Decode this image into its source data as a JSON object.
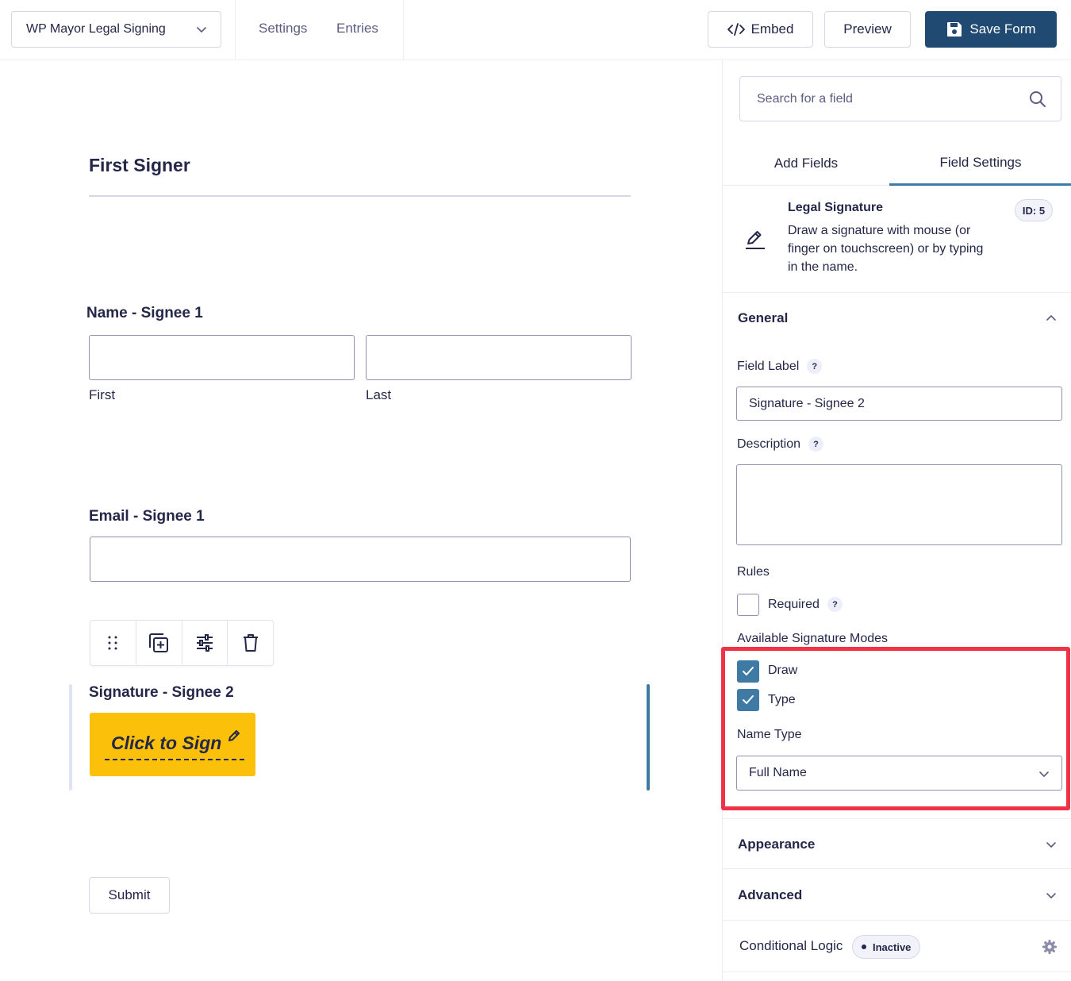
{
  "header": {
    "form_name": "WP Mayor Legal Signing",
    "nav": [
      "Settings",
      "Entries"
    ],
    "embed_label": "Embed",
    "preview_label": "Preview",
    "save_label": "Save Form"
  },
  "canvas": {
    "section_title": "First Signer",
    "name_field": {
      "label": "Name - Signee 1",
      "first_sublabel": "First",
      "last_sublabel": "Last"
    },
    "email_field": {
      "label": "Email - Signee 1"
    },
    "toolbar_icons": [
      "drag-handle-icon",
      "duplicate-icon",
      "settings-sliders-icon",
      "trash-icon"
    ],
    "signature_field": {
      "label": "Signature - Signee 2",
      "button_text": "Click to Sign"
    },
    "submit_label": "Submit"
  },
  "sidebar": {
    "search_placeholder": "Search for a field",
    "tabs": [
      "Add Fields",
      "Field Settings"
    ],
    "active_tab": "Field Settings",
    "field_info": {
      "title": "Legal Signature",
      "description": "Draw a signature with mouse (or finger on touchscreen) or by typing in the name.",
      "id_badge": "ID: 5"
    },
    "general": {
      "title": "General",
      "field_label_label": "Field Label",
      "field_label_value": "Signature - Signee 2",
      "description_label": "Description",
      "rules_label": "Rules",
      "required_label": "Required",
      "required_checked": false,
      "modes_label": "Available Signature Modes",
      "modes": [
        {
          "label": "Draw",
          "checked": true
        },
        {
          "label": "Type",
          "checked": true
        }
      ],
      "name_type_label": "Name Type",
      "name_type_value": "Full Name"
    },
    "appearance_title": "Appearance",
    "advanced_title": "Advanced",
    "conditional_logic": {
      "title": "Conditional Logic",
      "status": "Inactive"
    }
  },
  "colors": {
    "primary": "#204a72",
    "accent": "#3e7aa3",
    "sign_button": "#fbc10a",
    "highlight": "#ef3347",
    "text": "#242748"
  }
}
